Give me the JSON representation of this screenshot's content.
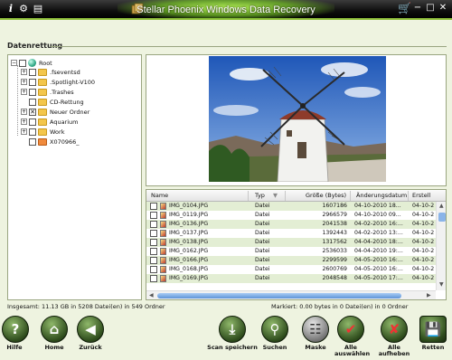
{
  "app": {
    "title": "Stellar Phoenix Windows Data Recovery"
  },
  "section": {
    "label": "Datenrettung"
  },
  "tree": {
    "root": "Root",
    "items": [
      {
        "label": ".fseventsd",
        "checked": false,
        "expander": "+"
      },
      {
        "label": ".Spotlight-V100",
        "checked": false,
        "expander": "+"
      },
      {
        "label": ".Trashes",
        "checked": false,
        "expander": "+"
      },
      {
        "label": "CD-Rettung",
        "checked": false,
        "expander": ""
      },
      {
        "label": "Neuer Ordner",
        "checked": true,
        "expander": "+"
      },
      {
        "label": "Aquarium",
        "checked": false,
        "expander": "+"
      },
      {
        "label": "Work",
        "checked": false,
        "expander": "+"
      },
      {
        "label": "X070966_",
        "checked": false,
        "expander": ""
      }
    ]
  },
  "list": {
    "columns": [
      "Name",
      "Typ",
      "Größe (Bytes)",
      "Änderungsdatum",
      "Erstell"
    ],
    "rows": [
      {
        "name": "IMG_0104.JPG",
        "type": "Datei",
        "size": "1607186",
        "modified": "04-10-2010 18...",
        "created": "04-10-2"
      },
      {
        "name": "IMG_0119.JPG",
        "type": "Datei",
        "size": "2966579",
        "modified": "04-10-2010 09...",
        "created": "04-10-2"
      },
      {
        "name": "IMG_0136.JPG",
        "type": "Datei",
        "size": "2041538",
        "modified": "04-02-2010 16:...",
        "created": "04-10-2"
      },
      {
        "name": "IMG_0137.JPG",
        "type": "Datei",
        "size": "1392443",
        "modified": "04-02-2010 13:...",
        "created": "04-10-2"
      },
      {
        "name": "IMG_0138.JPG",
        "type": "Datei",
        "size": "1317562",
        "modified": "04-04-2010 18:...",
        "created": "04-10-2"
      },
      {
        "name": "IMG_0162.JPG",
        "type": "Datei",
        "size": "2536033",
        "modified": "04-04-2010 19:...",
        "created": "04-10-2"
      },
      {
        "name": "IMG_0166.JPG",
        "type": "Datei",
        "size": "2299599",
        "modified": "04-05-2010 16:...",
        "created": "04-10-2"
      },
      {
        "name": "IMG_0168.JPG",
        "type": "Datei",
        "size": "2600769",
        "modified": "04-05-2010 16:...",
        "created": "04-10-2"
      },
      {
        "name": "IMG_0169.JPG",
        "type": "Datei",
        "size": "2048548",
        "modified": "04-05-2010 17:...",
        "created": "04-10-2"
      }
    ]
  },
  "status": {
    "left": "Insgesamt: 11.13 GB in 5208 Datei(en) in 549 Ordner",
    "right": "Markiert: 0.00 bytes in 0 Datei(en) in 0 Ordner"
  },
  "toolbar": {
    "help": "Hilfe",
    "home": "Home",
    "back": "Zurück",
    "save_scan": "Scan speichern",
    "search": "Suchen",
    "mask": "Maske",
    "select_all_1": "Alle",
    "select_all_2": "auswählen",
    "deselect_all_1": "Alle",
    "deselect_all_2": "aufheben",
    "recover": "Retten"
  },
  "colors": {
    "accent": "#8fbf3a",
    "row_alt": "#e3eed4",
    "button": "#2f4d1d"
  }
}
